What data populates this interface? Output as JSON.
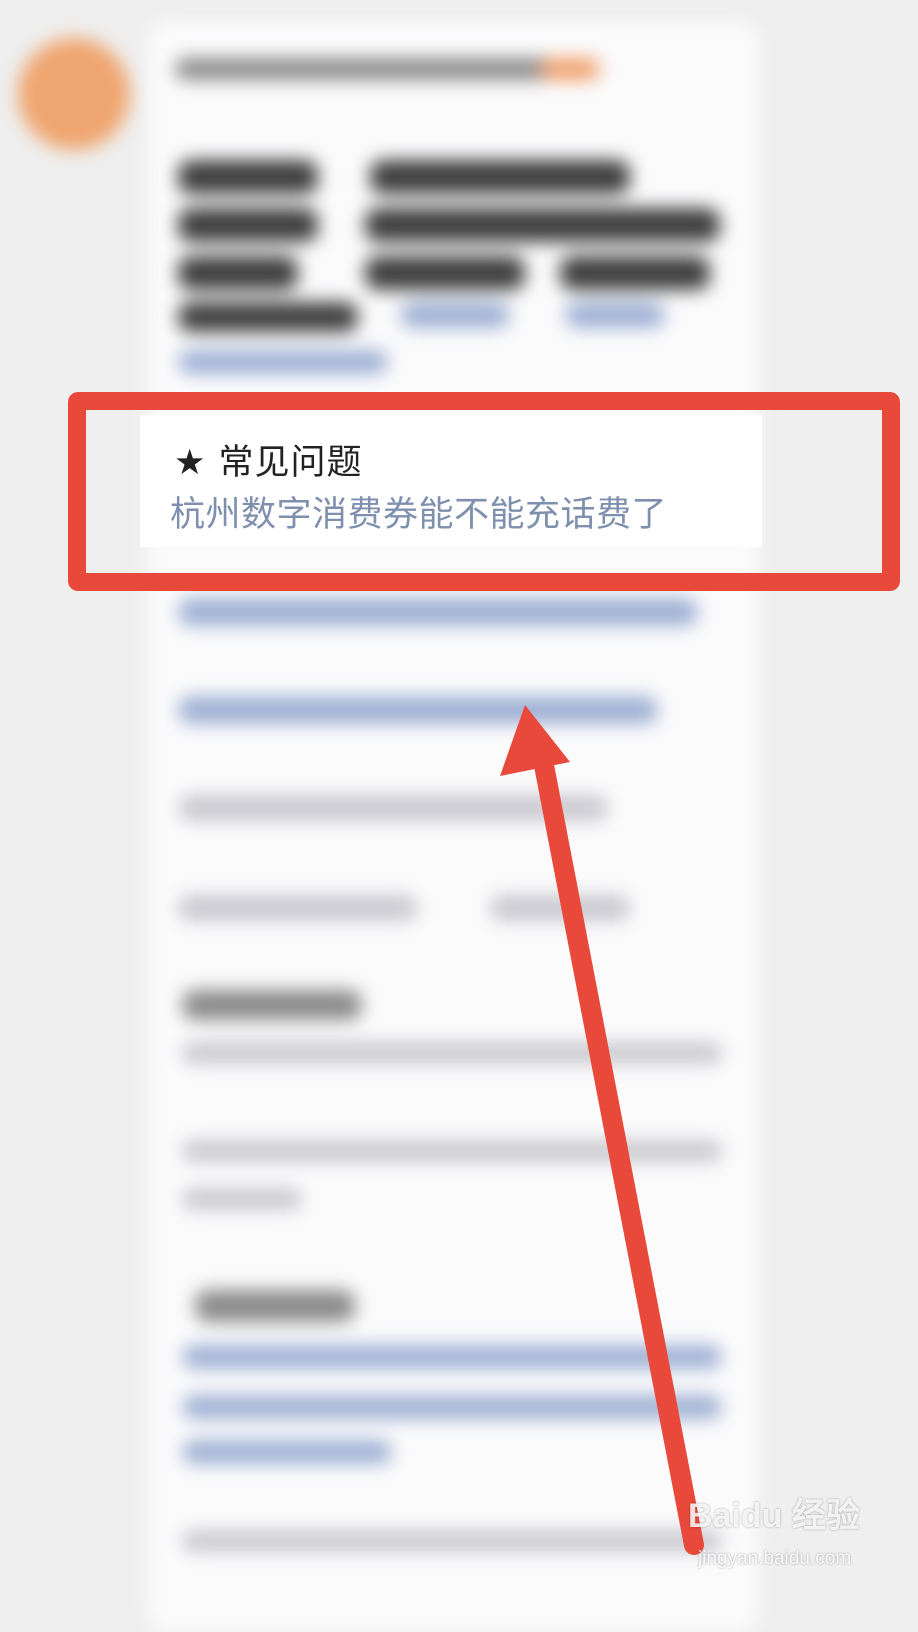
{
  "faq_card": {
    "icon": "star-icon",
    "title": "★ 常见问题",
    "question": "杭州数字消费券能不能充话费了"
  },
  "annotation": {
    "box_color": "#e8493b",
    "arrow_color": "#e8493b"
  },
  "watermark": {
    "brand": "Baidu 经验",
    "url": "jingyan.baidu.com"
  },
  "colors": {
    "background": "#efefef",
    "bubble": "#fbfbfc",
    "link_text": "#7f8fae",
    "avatar": "#efa56f"
  }
}
